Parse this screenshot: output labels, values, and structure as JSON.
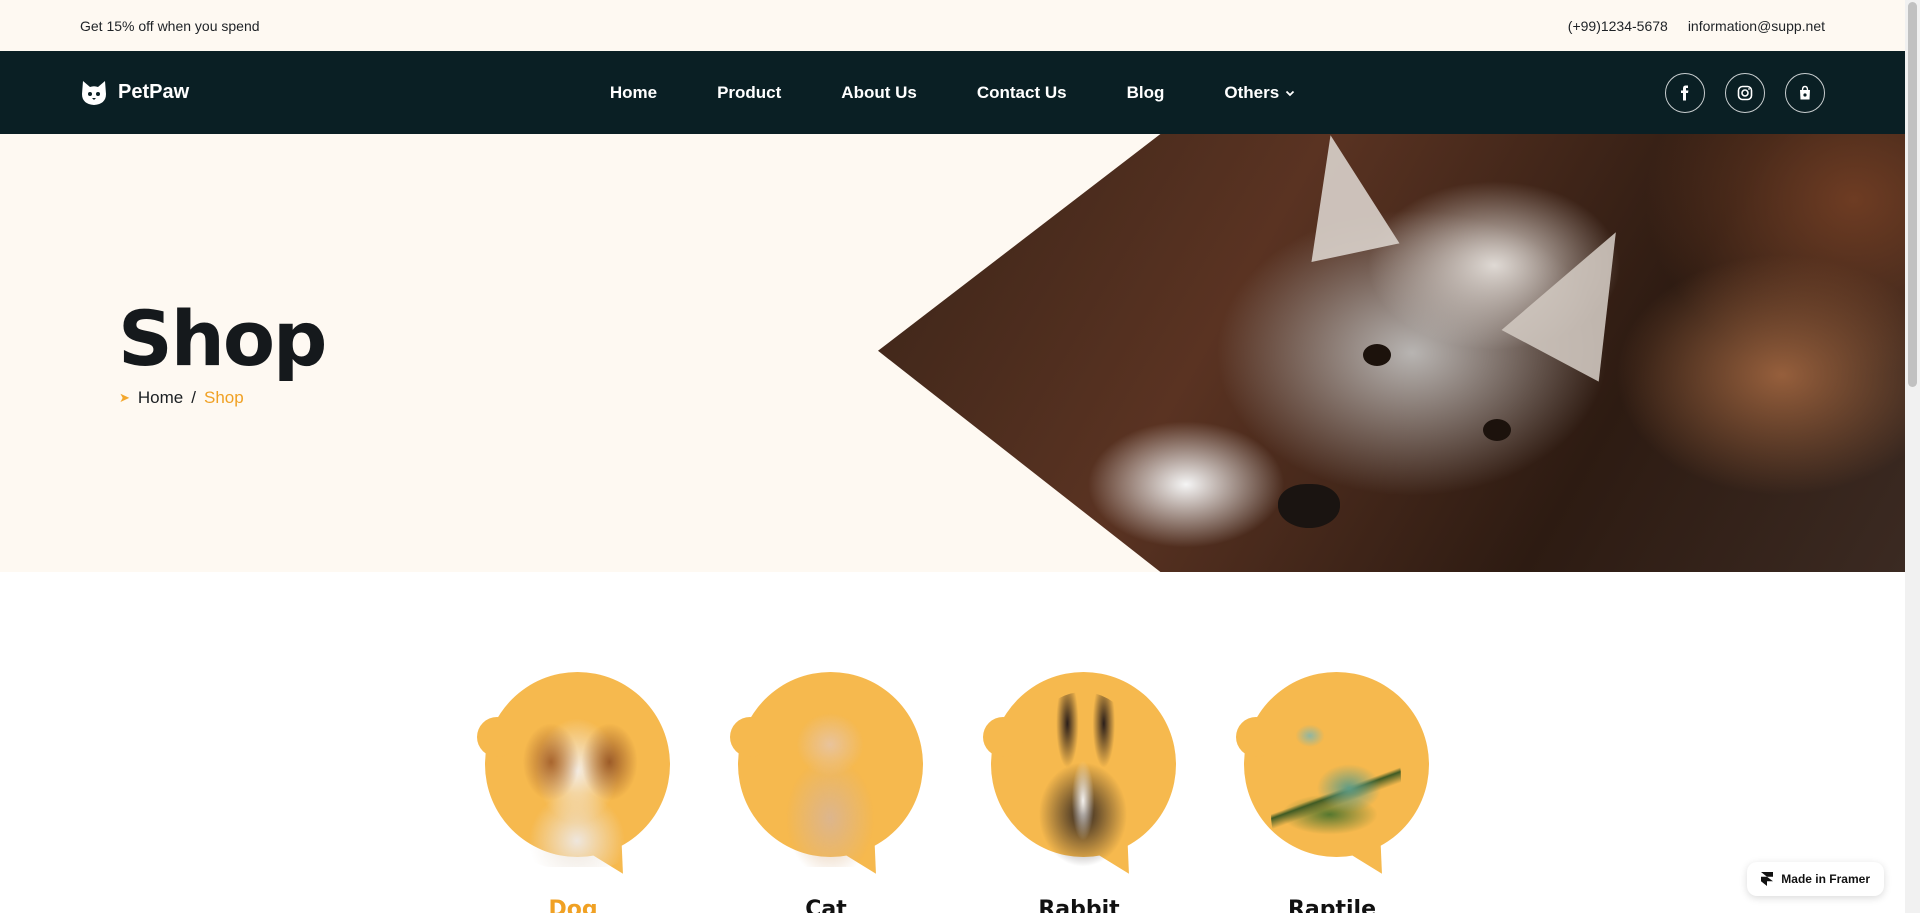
{
  "topbar": {
    "promo": "Get 15% off when you spend",
    "phone": "(+99)1234-5678",
    "email": "information@supp.net"
  },
  "brand": {
    "name": "PetPaw",
    "icon": "cat-head-icon"
  },
  "nav": {
    "items": [
      {
        "label": "Home"
      },
      {
        "label": "Product"
      },
      {
        "label": "About Us"
      },
      {
        "label": "Contact Us"
      },
      {
        "label": "Blog"
      },
      {
        "label": "Others",
        "has_dropdown": true
      }
    ],
    "social": [
      {
        "icon": "facebook-icon"
      },
      {
        "icon": "instagram-icon"
      },
      {
        "icon": "shopping-bag-icon"
      }
    ]
  },
  "hero": {
    "title": "Shop",
    "breadcrumb": {
      "home": "Home",
      "separator": "/",
      "current": "Shop"
    }
  },
  "categories": [
    {
      "label": "Dog",
      "active": true
    },
    {
      "label": "Cat",
      "active": false
    },
    {
      "label": "Rabbit",
      "active": false
    },
    {
      "label": "Raptile",
      "active": false
    }
  ],
  "framer_badge": {
    "label": "Made in Framer"
  },
  "colors": {
    "accent": "#f0a124",
    "nav_bg": "#0a1f24",
    "hero_bg": "#fef9f2",
    "blob": "#f6b94e"
  }
}
